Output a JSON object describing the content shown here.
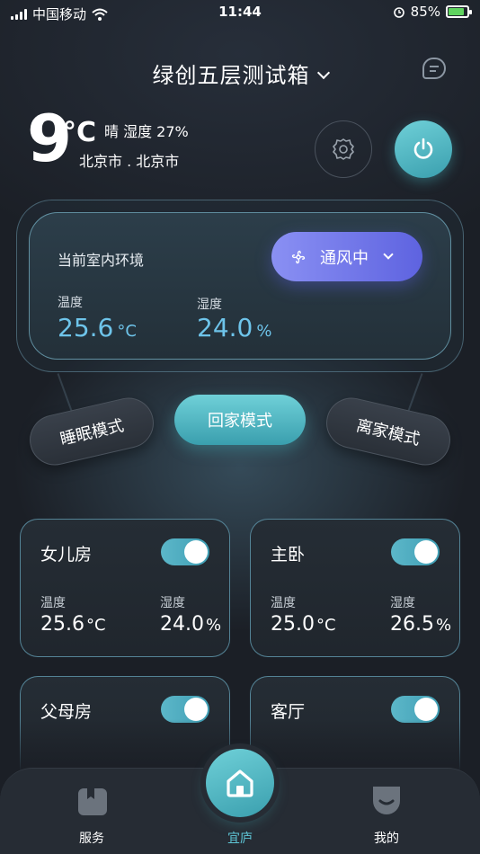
{
  "status_bar": {
    "carrier": "中国移动",
    "time": "11:44",
    "battery": "85%"
  },
  "header": {
    "device_name": "绿创五层测试箱"
  },
  "weather": {
    "temperature": "9",
    "unit": "°C",
    "description": "晴 湿度 27%",
    "city": "北京市 . 北京市"
  },
  "environment": {
    "label": "当前室内环境",
    "vent_status": "通风中",
    "temperature_label": "温度",
    "temperature_value": "25.6",
    "temperature_unit": "°C",
    "humidity_label": "湿度",
    "humidity_value": "24.0",
    "humidity_unit": "%"
  },
  "modes": {
    "sleep": "睡眠模式",
    "home": "回家模式",
    "away": "离家模式"
  },
  "rooms": [
    {
      "name": "女儿房",
      "on": true,
      "temp_label": "温度",
      "temp": "25.6",
      "temp_unit": "°C",
      "hum_label": "湿度",
      "hum": "24.0",
      "hum_unit": "%"
    },
    {
      "name": "主卧",
      "on": true,
      "temp_label": "温度",
      "temp": "25.0",
      "temp_unit": "°C",
      "hum_label": "湿度",
      "hum": "26.5",
      "hum_unit": "%"
    },
    {
      "name": "父母房",
      "on": true
    },
    {
      "name": "客厅",
      "on": true
    }
  ],
  "nav": {
    "services": "服务",
    "home": "宜庐",
    "mine": "我的"
  },
  "colors": {
    "accent": "#4fb6c4",
    "vent_button": "#6d72ea",
    "value_blue": "#6ec4ea"
  }
}
